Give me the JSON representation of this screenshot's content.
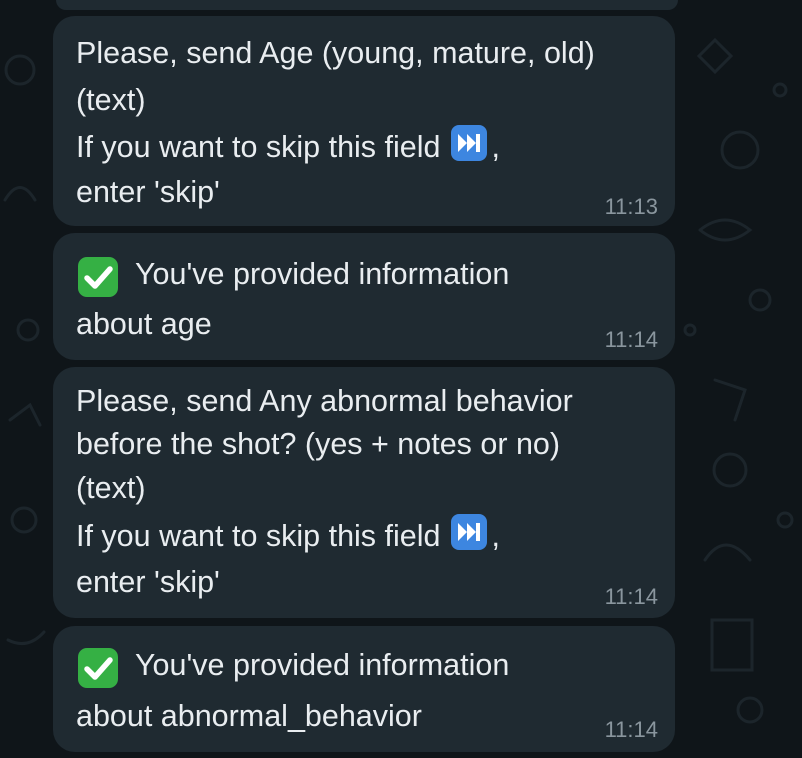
{
  "messages": [
    {
      "lines": [
        "Please, send Age (young, mature, old)",
        "(text)"
      ],
      "skip_line": " If you want to skip this field",
      "skip_suffix": ",",
      "last_line": "enter 'skip'",
      "time": "11:13",
      "skip_icon": "next-track-emoji"
    },
    {
      "check_icon": "check-mark-emoji",
      "line1": "You've provided information",
      "line2": "about age",
      "time": "11:14"
    },
    {
      "lines": [
        "Please, send Any abnormal behavior",
        "before the shot? (yes + notes or no)",
        "(text)"
      ],
      "skip_line": " If you want to skip this field",
      "skip_suffix": ",",
      "last_line": "enter 'skip'",
      "time": "11:14",
      "skip_icon": "next-track-emoji"
    },
    {
      "check_icon": "check-mark-emoji",
      "line1": "You've provided information",
      "line2": "about abnormal_behavior",
      "time": "11:14"
    }
  ],
  "colors": {
    "background": "#0f1519",
    "bubble": "#1f2a31",
    "text": "#e9edf0",
    "timestamp": "#8a969e",
    "check_green": "#35b044",
    "skip_blue": "#3d86e0"
  }
}
